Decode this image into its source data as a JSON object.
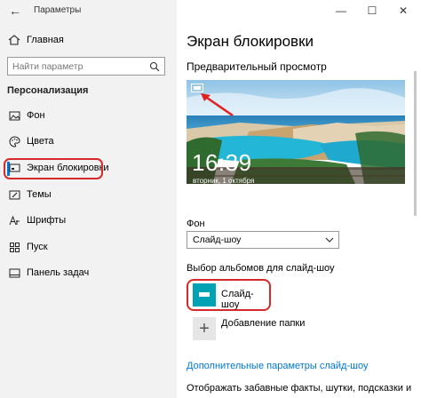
{
  "window": {
    "title": "Параметры",
    "controls": {
      "minimize": "—",
      "maximize": "☐",
      "close": "✕"
    }
  },
  "sidebar": {
    "back_icon": "arrow-left-icon",
    "home_label": "Главная",
    "search_placeholder": "Найти параметр",
    "section_title": "Персонализация",
    "items": [
      {
        "label": "Фон",
        "icon": "image-icon"
      },
      {
        "label": "Цвета",
        "icon": "palette-icon"
      },
      {
        "label": "Экран блокировки",
        "icon": "monitor-icon",
        "active": true
      },
      {
        "label": "Темы",
        "icon": "brush-icon"
      },
      {
        "label": "Шрифты",
        "icon": "font-icon"
      },
      {
        "label": "Пуск",
        "icon": "grid-icon"
      },
      {
        "label": "Панель задач",
        "icon": "taskbar-icon"
      }
    ]
  },
  "main": {
    "title": "Экран блокировки",
    "preview_title": "Предварительный просмотр",
    "preview_clock": "16:39",
    "preview_date": "вторник, 1 октября",
    "background_label": "Фон",
    "background_value": "Слайд-шоу",
    "albums_label": "Выбор альбомов для слайд-шоу",
    "album_name": "Слайд-шоу",
    "add_folder_label": "Добавление папки",
    "advanced_link": "Дополнительные параметры слайд-шоу",
    "bottom_text": "Отображать забавные факты, шутки, подсказки и"
  },
  "colors": {
    "accent": "#0078d7",
    "highlight": "#d62a2a",
    "album_tile": "#00a2b3",
    "sidebar_bg": "#f2f2f2"
  }
}
